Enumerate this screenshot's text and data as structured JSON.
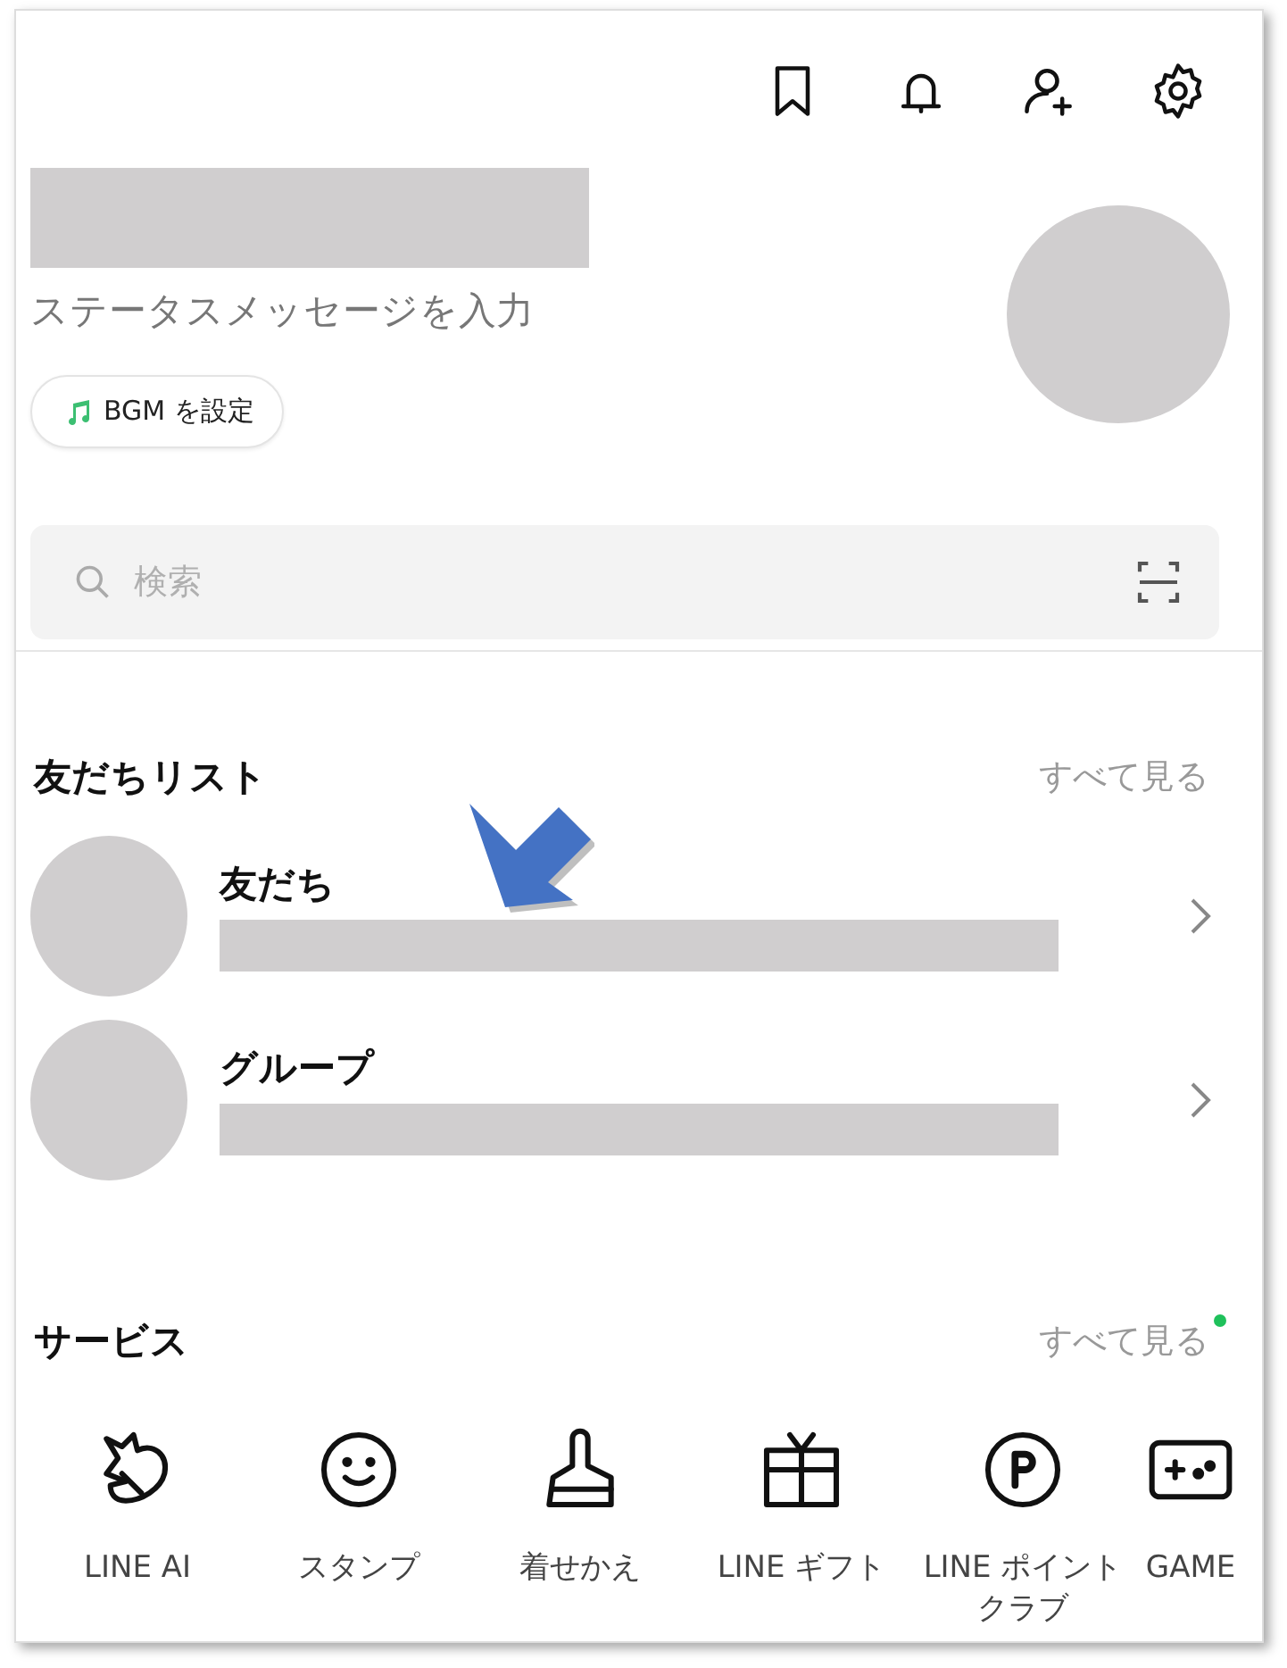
{
  "header": {
    "actions": [
      {
        "kind": "bookmark"
      },
      {
        "kind": "bell"
      },
      {
        "kind": "add-friend"
      },
      {
        "kind": "settings"
      }
    ]
  },
  "profile": {
    "status_placeholder": "ステータスメッセージを入力",
    "bgm_button": "BGM を設定"
  },
  "search": {
    "placeholder": "検索"
  },
  "friends_section": {
    "title": "友だちリスト",
    "see_all": "すべて見る",
    "rows": [
      {
        "label": "友だち"
      },
      {
        "label": "グループ"
      }
    ]
  },
  "services_section": {
    "title": "サービス",
    "see_all": "すべて見る",
    "see_all_badge": true,
    "items": [
      {
        "kind": "ai",
        "label": "LINE AI"
      },
      {
        "kind": "smile",
        "label": "スタンプ"
      },
      {
        "kind": "brush",
        "label": "着せかえ"
      },
      {
        "kind": "gift",
        "label": "LINE ギフト"
      },
      {
        "kind": "points",
        "label": "LINE ポイントクラブ"
      },
      {
        "kind": "game",
        "label": "GAME"
      }
    ]
  }
}
